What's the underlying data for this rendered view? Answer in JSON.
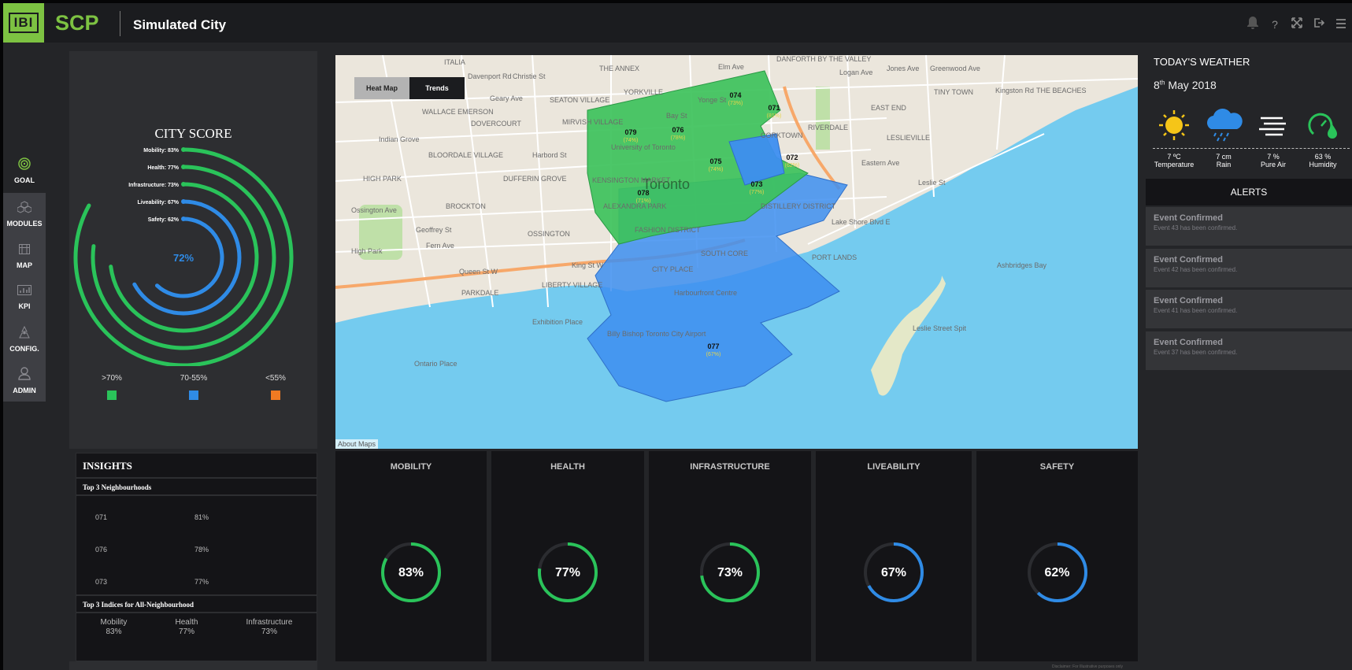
{
  "header": {
    "logo_text": "IBI",
    "brand": "SCP",
    "city_name": "Simulated City",
    "icons": [
      "bell-icon",
      "help-icon",
      "fullscreen-icon",
      "logout-icon",
      "menu-icon"
    ],
    "help_glyph": "?"
  },
  "nav": {
    "items": [
      {
        "label": "GOAL",
        "icon": "target-icon"
      },
      {
        "label": "MODULES",
        "icon": "modules-icon"
      },
      {
        "label": "MAP",
        "icon": "map-icon"
      },
      {
        "label": "KPI",
        "icon": "kpi-icon"
      },
      {
        "label": "CONFIG.",
        "icon": "config-icon"
      },
      {
        "label": "ADMIN",
        "icon": "admin-icon"
      }
    ]
  },
  "city_score": {
    "title": "CITY SCORE",
    "overall": "72%",
    "overall_value": 72,
    "rings": [
      {
        "label": "Mobility: 83%",
        "value": 83,
        "color": "#2ac35a"
      },
      {
        "label": "Health: 77%",
        "value": 77,
        "color": "#2ac35a"
      },
      {
        "label": "Infrastructure: 73%",
        "value": 73,
        "color": "#2ac35a"
      },
      {
        "label": "Liveability: 67%",
        "value": 67,
        "color": "#2f8be6"
      },
      {
        "label": "Safety: 62%",
        "value": 62,
        "color": "#2f8be6"
      }
    ],
    "legend": [
      {
        "label": ">70%",
        "color": "#2ac35a"
      },
      {
        "label": "70-55%",
        "color": "#2f8be6"
      },
      {
        "label": "<55%",
        "color": "#f07a22"
      }
    ]
  },
  "insights": {
    "title": "INSIGHTS",
    "top_neighbourhoods_title": "Top 3 Neighbourhoods",
    "top_neighbourhoods": [
      {
        "id": "071",
        "value": "81%"
      },
      {
        "id": "076",
        "value": "78%"
      },
      {
        "id": "073",
        "value": "77%"
      }
    ],
    "top_indices_title": "Top 3 Indices for All-Neighbourhood",
    "top_indices": [
      {
        "name": "Mobility",
        "value": "83%"
      },
      {
        "name": "Health",
        "value": "77%"
      },
      {
        "name": "Infrastructure",
        "value": "73%"
      }
    ]
  },
  "map": {
    "toggle_heat": "Heat Map",
    "toggle_trends": "Trends",
    "about": "About Maps",
    "city_label": "Toronto",
    "district_labels": [
      {
        "id": "074",
        "pct": "(73%)"
      },
      {
        "id": "071",
        "pct": "(81%)"
      },
      {
        "id": "079",
        "pct": "(74%)"
      },
      {
        "id": "076",
        "pct": "(78%)"
      },
      {
        "id": "072",
        "pct": "(62%)"
      },
      {
        "id": "075",
        "pct": "(74%)"
      },
      {
        "id": "073",
        "pct": "(77%)"
      },
      {
        "id": "078",
        "pct": "(71%)"
      },
      {
        "id": "077",
        "pct": "(67%)"
      }
    ],
    "place_labels": [
      "ITALIA",
      "Davenport Rd",
      "THE ANNEX",
      "YORKVILLE",
      "DANFORTH BY THE VALLEY",
      "TINY TOWN",
      "THE BEACHES",
      "WALLACE EMERSON",
      "DOVERCOURT",
      "SEATON VILLAGE",
      "MIRVISH VILLAGE",
      "EAST END",
      "LESLIEVILLE",
      "BLOORDALE VILLAGE",
      "Harbord St",
      "HIGH PARK",
      "DUFFERIN GROVE",
      "Eastern Ave",
      "BROCKTON",
      "Geoffrey St",
      "Fern Ave",
      "OSSINGTON",
      "High Park",
      "Queen St W",
      "King St W",
      "LIBERTY VILLAGE",
      "PARKDALE",
      "PORT LANDS",
      "Exhibition Place",
      "Billy Bishop Toronto City Airport",
      "Leslie Street Spit",
      "Lake Shore Blvd E",
      "Leslie St",
      "Kingston Rd",
      "Geary Ave",
      "Indian Grove",
      "Elm Ave",
      "Logan Ave",
      "KENSINGTON MARKET",
      "ALEXANDRA PARK",
      "FASHION DISTRICT",
      "SOUTH CORE",
      "CITY PLACE",
      "DISTILLERY DISTRICT",
      "University of Toronto",
      "Christie St",
      "Jones Ave",
      "Greenwood Ave",
      "RIVERDALE",
      "CORKTOWN",
      "Harbourfront Centre",
      "Ashbridges Bay",
      "Bay St",
      "Yonge St",
      "Ossington Ave",
      "Ontario Place"
    ]
  },
  "kpis": [
    {
      "label": "MOBILITY",
      "value_text": "83%",
      "value": 83,
      "color": "#2ac35a"
    },
    {
      "label": "HEALTH",
      "value_text": "77%",
      "value": 77,
      "color": "#2ac35a"
    },
    {
      "label": "INFRASTRUCTURE",
      "value_text": "73%",
      "value": 73,
      "color": "#2ac35a"
    },
    {
      "label": "LIVEABILITY",
      "value_text": "67%",
      "value": 67,
      "color": "#2f8be6"
    },
    {
      "label": "SAFETY",
      "value_text": "62%",
      "value": 62,
      "color": "#2f8be6"
    }
  ],
  "weather": {
    "title": "TODAY'S WEATHER",
    "date_day": "8",
    "date_suffix": "th",
    "date_rest": " May 2018",
    "items": [
      {
        "value": "7 ºC",
        "label": "Temperature",
        "icon": "sun-icon"
      },
      {
        "value": "7 cm",
        "label": "Rain",
        "icon": "rain-cloud-icon"
      },
      {
        "value": "7 %",
        "label": "Pure Air",
        "icon": "wind-icon"
      },
      {
        "value": "63 %",
        "label": "Humidity",
        "icon": "humidity-icon"
      }
    ]
  },
  "alerts": {
    "title": "ALERTS",
    "items": [
      {
        "title": "Event Confirmed",
        "desc": "Event 43 has been confirmed."
      },
      {
        "title": "Event Confirmed",
        "desc": "Event 42 has been confirmed."
      },
      {
        "title": "Event Confirmed",
        "desc": "Event 41 has been confirmed."
      },
      {
        "title": "Event Confirmed",
        "desc": "Event 37 has been confirmed."
      }
    ]
  },
  "footer": {
    "disclaimer": "Disclaimer: For Illustrative purposes only"
  },
  "colors": {
    "brand_green": "#7dc242",
    "score_green": "#2ac35a",
    "score_blue": "#2f8be6",
    "score_orange": "#f07a22",
    "map_green": "#3dc25b",
    "map_blue": "#3d8ef0",
    "water": "#74cbef"
  }
}
